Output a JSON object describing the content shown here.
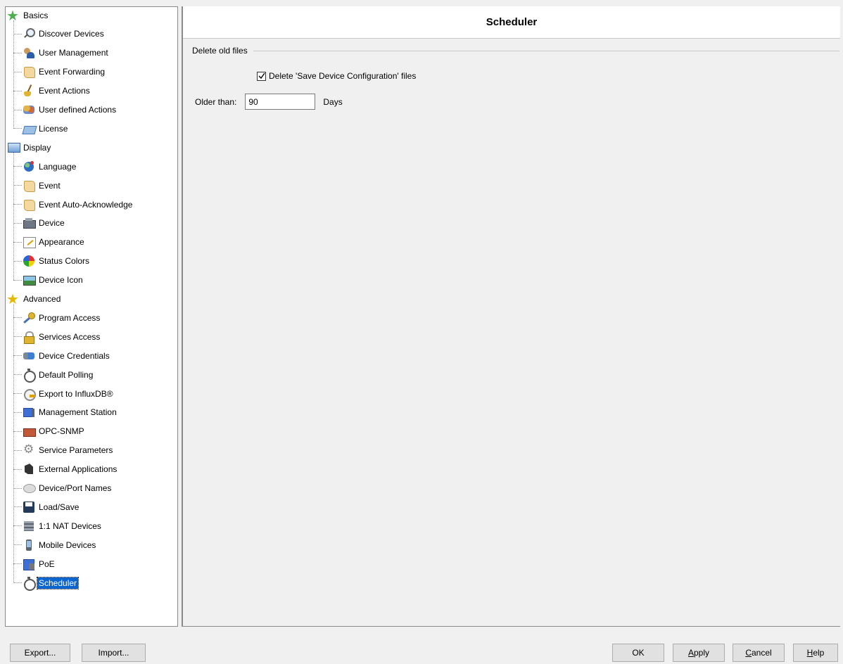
{
  "tree": {
    "categories": [
      {
        "label": "Basics",
        "icon": "green-star-icon",
        "items": [
          {
            "label": "Discover Devices",
            "icon": "magnifier-icon"
          },
          {
            "label": "User Management",
            "icon": "users-icon"
          },
          {
            "label": "Event Forwarding",
            "icon": "scroll-icon"
          },
          {
            "label": "Event Actions",
            "icon": "broom-icon"
          },
          {
            "label": "User defined Actions",
            "icon": "people-icon"
          },
          {
            "label": "License",
            "icon": "license-icon"
          }
        ]
      },
      {
        "label": "Display",
        "icon": "monitor-icon",
        "items": [
          {
            "label": "Language",
            "icon": "globe-icon"
          },
          {
            "label": "Event",
            "icon": "scroll-icon"
          },
          {
            "label": "Event Auto-Acknowledge",
            "icon": "scroll-icon"
          },
          {
            "label": "Device",
            "icon": "device-icon"
          },
          {
            "label": "Appearance",
            "icon": "appearance-icon"
          },
          {
            "label": "Status Colors",
            "icon": "color-wheel-icon"
          },
          {
            "label": "Device Icon",
            "icon": "device-image-icon"
          }
        ]
      },
      {
        "label": "Advanced",
        "icon": "yellow-star-icon",
        "items": [
          {
            "label": "Program Access",
            "icon": "key-icon"
          },
          {
            "label": "Services Access",
            "icon": "lock-icon"
          },
          {
            "label": "Device Credentials",
            "icon": "credentials-icon"
          },
          {
            "label": "Default Polling",
            "icon": "stopwatch-icon"
          },
          {
            "label": "Export to InfluxDB®",
            "icon": "export-icon"
          },
          {
            "label": "Management Station",
            "icon": "station-icon"
          },
          {
            "label": "OPC-SNMP",
            "icon": "opc-icon"
          },
          {
            "label": "Service Parameters",
            "icon": "gears-icon"
          },
          {
            "label": "External Applications",
            "icon": "external-app-icon"
          },
          {
            "label": "Device/Port Names",
            "icon": "speech-bubble-icon"
          },
          {
            "label": "Load/Save",
            "icon": "floppy-disk-icon"
          },
          {
            "label": "1:1 NAT Devices",
            "icon": "nat-icon"
          },
          {
            "label": "Mobile Devices",
            "icon": "mobile-icon"
          },
          {
            "label": "PoE",
            "icon": "poe-icon"
          },
          {
            "label": "Scheduler",
            "icon": "stopwatch-icon",
            "selected": true
          }
        ]
      }
    ]
  },
  "main": {
    "title": "Scheduler",
    "group_title": "Delete old files",
    "delete_checkbox": {
      "label": "Delete 'Save Device Configuration' files",
      "checked": true
    },
    "older_than": {
      "label": "Older than:",
      "value": "90",
      "unit": "Days"
    }
  },
  "buttons": {
    "export": "Export...",
    "import": "Import...",
    "ok": "OK",
    "apply": "Apply",
    "cancel": "Cancel",
    "help": "Help"
  },
  "colors": {
    "selection": "#0a64d2",
    "star_green": "#4caf50",
    "star_yellow": "#e6b800"
  }
}
